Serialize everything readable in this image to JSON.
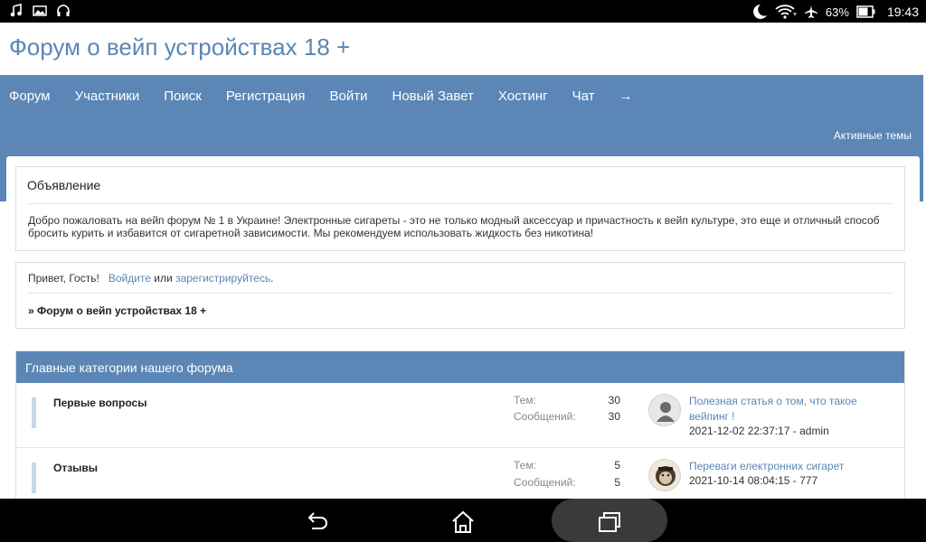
{
  "status_bar": {
    "left_icons": [
      "music-icon",
      "image-icon",
      "headphones-icon"
    ],
    "right_icons": [
      "moon-icon",
      "wifi-icon",
      "airplane-icon",
      "battery-icon"
    ],
    "battery": "63%",
    "time": "19:43"
  },
  "site": {
    "title": "Форум о вейп устройствах 18 +"
  },
  "nav": {
    "items": [
      "Форум",
      "Участники",
      "Поиск",
      "Регистрация",
      "Войти",
      "Новый Завет",
      "Хостинг",
      "Чат",
      "→"
    ]
  },
  "subbar": {
    "active_topics": "Активные темы"
  },
  "announcement": {
    "header": "Объявление",
    "text": "Добро пожаловать на вейп форум № 1 в Украине! Электронные сигареты - это не только модный аксессуар и причастность к вейп культуре, это еще и отличный способ бросить курить и избавится от сигаретной зависимости. Мы рекомендуем использовать жидкость без никотина!"
  },
  "greeting": {
    "hello": "Привет, Гость!",
    "login": "Войдите",
    "or": "или",
    "register": "зарегистрируйтесь",
    "dot": ".",
    "breadcrumb": "» Форум о вейп устройствах 18 +"
  },
  "category": {
    "title": "Главные категории нашего форума",
    "topics_label": "Тем:",
    "posts_label": "Сообщений:",
    "forums": [
      {
        "name": "Первые вопросы",
        "topics": "30",
        "posts": "30",
        "last_title": "Полезная статья о том, что такое вейпинг !",
        "last_meta": "2021-12-02 22:37:17 - admin"
      },
      {
        "name": "Отзывы",
        "topics": "5",
        "posts": "5",
        "last_title": "Переваги електронних сигарет",
        "last_meta": "2021-10-14 08:04:15 - 777"
      }
    ]
  },
  "system_nav": {
    "buttons": [
      "back-icon",
      "home-icon",
      "recents-icon"
    ]
  }
}
